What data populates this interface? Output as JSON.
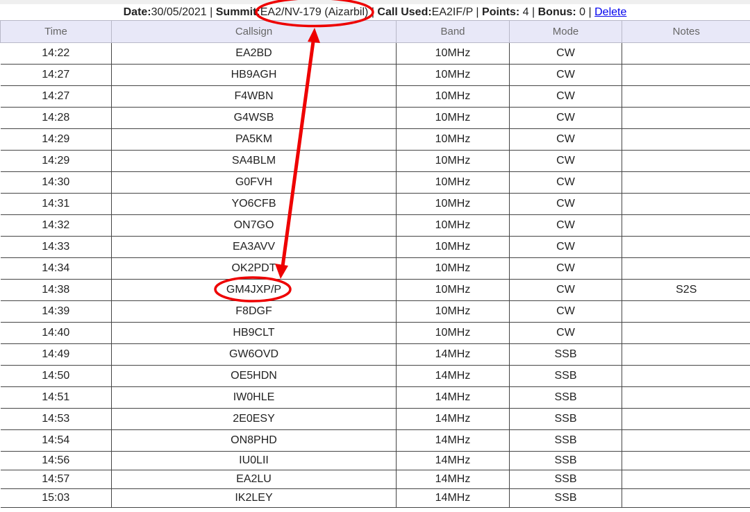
{
  "header": {
    "date_label": "Date:",
    "date_value": "30/05/2021",
    "sep1": " | ",
    "summit_label": "Summit:",
    "summit_value": "EA2/NV-179 (Aizarbil)",
    "sep2": " | ",
    "call_label": "Call Used:",
    "call_value": "EA2IF/P",
    "sep3": " | ",
    "points_label": "Points:",
    "points_value": " 4",
    "sep4": " | ",
    "bonus_label": "Bonus:",
    "bonus_value": " 0",
    "sep5": " | ",
    "delete_link": "Delete"
  },
  "columns": [
    "Time",
    "Callsign",
    "Band",
    "Mode",
    "Notes"
  ],
  "rows": [
    {
      "time": "14:22",
      "callsign": "EA2BD",
      "band": "10MHz",
      "mode": "CW",
      "notes": ""
    },
    {
      "time": "14:27",
      "callsign": "HB9AGH",
      "band": "10MHz",
      "mode": "CW",
      "notes": ""
    },
    {
      "time": "14:27",
      "callsign": "F4WBN",
      "band": "10MHz",
      "mode": "CW",
      "notes": ""
    },
    {
      "time": "14:28",
      "callsign": "G4WSB",
      "band": "10MHz",
      "mode": "CW",
      "notes": ""
    },
    {
      "time": "14:29",
      "callsign": "PA5KM",
      "band": "10MHz",
      "mode": "CW",
      "notes": ""
    },
    {
      "time": "14:29",
      "callsign": "SA4BLM",
      "band": "10MHz",
      "mode": "CW",
      "notes": ""
    },
    {
      "time": "14:30",
      "callsign": "G0FVH",
      "band": "10MHz",
      "mode": "CW",
      "notes": ""
    },
    {
      "time": "14:31",
      "callsign": "YO6CFB",
      "band": "10MHz",
      "mode": "CW",
      "notes": ""
    },
    {
      "time": "14:32",
      "callsign": "ON7GO",
      "band": "10MHz",
      "mode": "CW",
      "notes": ""
    },
    {
      "time": "14:33",
      "callsign": "EA3AVV",
      "band": "10MHz",
      "mode": "CW",
      "notes": ""
    },
    {
      "time": "14:34",
      "callsign": "OK2PDT",
      "band": "10MHz",
      "mode": "CW",
      "notes": ""
    },
    {
      "time": "14:38",
      "callsign": "GM4JXP/P",
      "band": "10MHz",
      "mode": "CW",
      "notes": "S2S"
    },
    {
      "time": "14:39",
      "callsign": "F8DGF",
      "band": "10MHz",
      "mode": "CW",
      "notes": ""
    },
    {
      "time": "14:40",
      "callsign": "HB9CLT",
      "band": "10MHz",
      "mode": "CW",
      "notes": ""
    },
    {
      "time": "14:49",
      "callsign": "GW6OVD",
      "band": "14MHz",
      "mode": "SSB",
      "notes": ""
    },
    {
      "time": "14:50",
      "callsign": "OE5HDN",
      "band": "14MHz",
      "mode": "SSB",
      "notes": ""
    },
    {
      "time": "14:51",
      "callsign": "IW0HLE",
      "band": "14MHz",
      "mode": "SSB",
      "notes": ""
    },
    {
      "time": "14:53",
      "callsign": "2E0ESY",
      "band": "14MHz",
      "mode": "SSB",
      "notes": ""
    },
    {
      "time": "14:54",
      "callsign": "ON8PHD",
      "band": "14MHz",
      "mode": "SSB",
      "notes": ""
    },
    {
      "time": "14:56",
      "callsign": "IU0LII",
      "band": "14MHz",
      "mode": "SSB",
      "notes": ""
    },
    {
      "time": "14:57",
      "callsign": "EA2LU",
      "band": "14MHz",
      "mode": "SSB",
      "notes": ""
    },
    {
      "time": "15:03",
      "callsign": "IK2LEY",
      "band": "14MHz",
      "mode": "SSB",
      "notes": ""
    }
  ],
  "colors": {
    "header_bg": "#e8e8f8",
    "link": "#0000ee",
    "annotation": "#ee0000"
  }
}
